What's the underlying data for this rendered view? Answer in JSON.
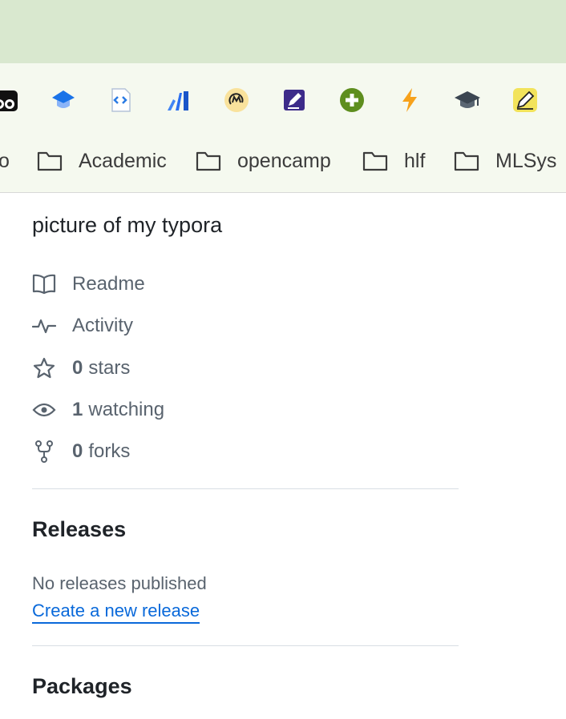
{
  "extensions": [
    {
      "name": "owl-extension-icon"
    },
    {
      "name": "graduation-cap-blue-icon"
    },
    {
      "name": "code-file-icon"
    },
    {
      "name": "bar-chart-icon"
    },
    {
      "name": "m-badge-icon"
    },
    {
      "name": "edit-note-icon"
    },
    {
      "name": "plus-circle-icon"
    },
    {
      "name": "lightning-icon"
    },
    {
      "name": "mortarboard-icon"
    },
    {
      "name": "pen-yellow-icon"
    }
  ],
  "bookmarks": {
    "partial": "o",
    "academic": "Academic",
    "opencamp": "opencamp",
    "hlf": "hlf",
    "mlsys": "MLSys"
  },
  "about": {
    "description": "picture of my typora",
    "readme": "Readme",
    "activity": "Activity",
    "stars_count": "0",
    "stars_label": "stars",
    "watching_count": "1",
    "watching_label": "watching",
    "forks_count": "0",
    "forks_label": "forks"
  },
  "releases": {
    "title": "Releases",
    "empty_text": "No releases published",
    "create_link": "Create a new release"
  },
  "packages": {
    "title": "Packages"
  },
  "colors": {
    "link": "#0969da",
    "muted": "#59636e",
    "title_bar": "#d9e8cf",
    "toolbar": "#f5f9ef"
  }
}
